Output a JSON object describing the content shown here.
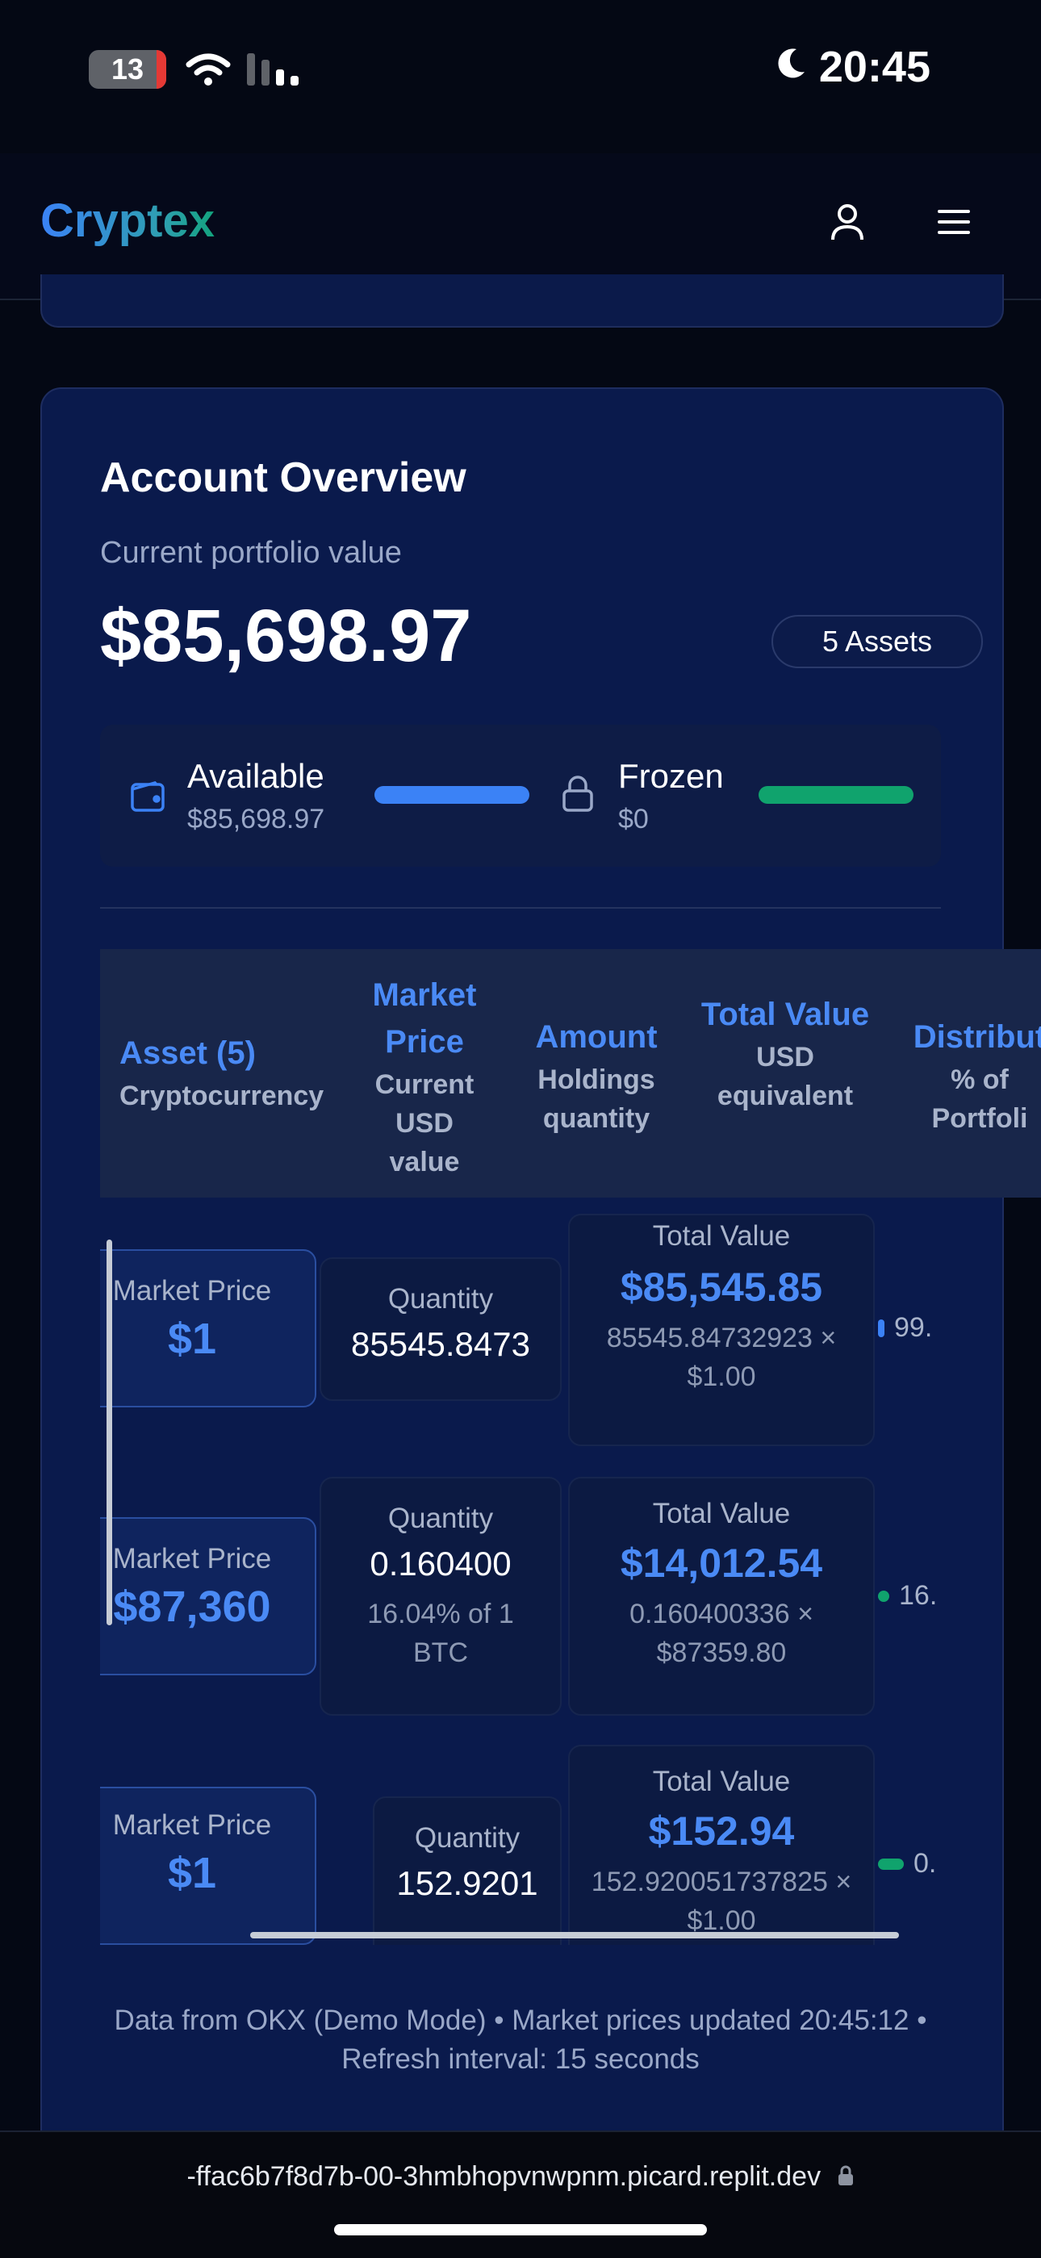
{
  "status": {
    "battery": "13",
    "time": "20:45"
  },
  "header": {
    "brand": "Cryptex"
  },
  "overview": {
    "title": "Account Overview",
    "subtitle": "Current portfolio value",
    "total_value": "$85,698.97",
    "assets_badge": "5 Assets",
    "available_label": "Available",
    "available_value": "$85,698.97",
    "frozen_label": "Frozen",
    "frozen_value": "$0",
    "available_color": "#3b82f6",
    "frozen_color": "#10a36d"
  },
  "table": {
    "headers": [
      {
        "main": "Asset (5)",
        "sub": "Cryptocurrency"
      },
      {
        "main": "Market Price",
        "sub": "Current USD value"
      },
      {
        "main": "Amount",
        "sub": "Holdings quantity"
      },
      {
        "main": "Total Value",
        "sub": "USD equivalent"
      },
      {
        "main": "Distribut",
        "sub": "% of Portfoli"
      }
    ],
    "rows": [
      {
        "price_label": "Market Price",
        "price": "$1",
        "qty_label": "Quantity",
        "qty": "85545.8473",
        "qty_note": "",
        "total_label": "Total Value",
        "total": "$85,545.85",
        "calc": "85545.84732923 × $1.00",
        "dist": "99.",
        "dist_color": "#3b82f6"
      },
      {
        "price_label": "Market Price",
        "price": "$87,360",
        "qty_label": "Quantity",
        "qty": "0.160400",
        "qty_note": "16.04% of 1 BTC",
        "total_label": "Total Value",
        "total": "$14,012.54",
        "calc": "0.160400336 × $87359.80",
        "dist": "16.",
        "dist_color": "#10a36d"
      },
      {
        "price_label": "Market Price",
        "price": "$1",
        "qty_label": "Quantity",
        "qty": "152.9201",
        "qty_note": "",
        "total_label": "Total Value",
        "total": "$152.94",
        "calc": "152.920051737825 × $1.00",
        "dist": "0.",
        "dist_color": "#10a36d"
      }
    ]
  },
  "footer": {
    "note": "Data from OKX (Demo Mode) • Market prices updated 20:45:12 • Refresh interval: 15 seconds"
  },
  "browser": {
    "url": "-ffac6b7f8d7b-00-3hmbhopvnwpnm.picard.replit.dev"
  }
}
